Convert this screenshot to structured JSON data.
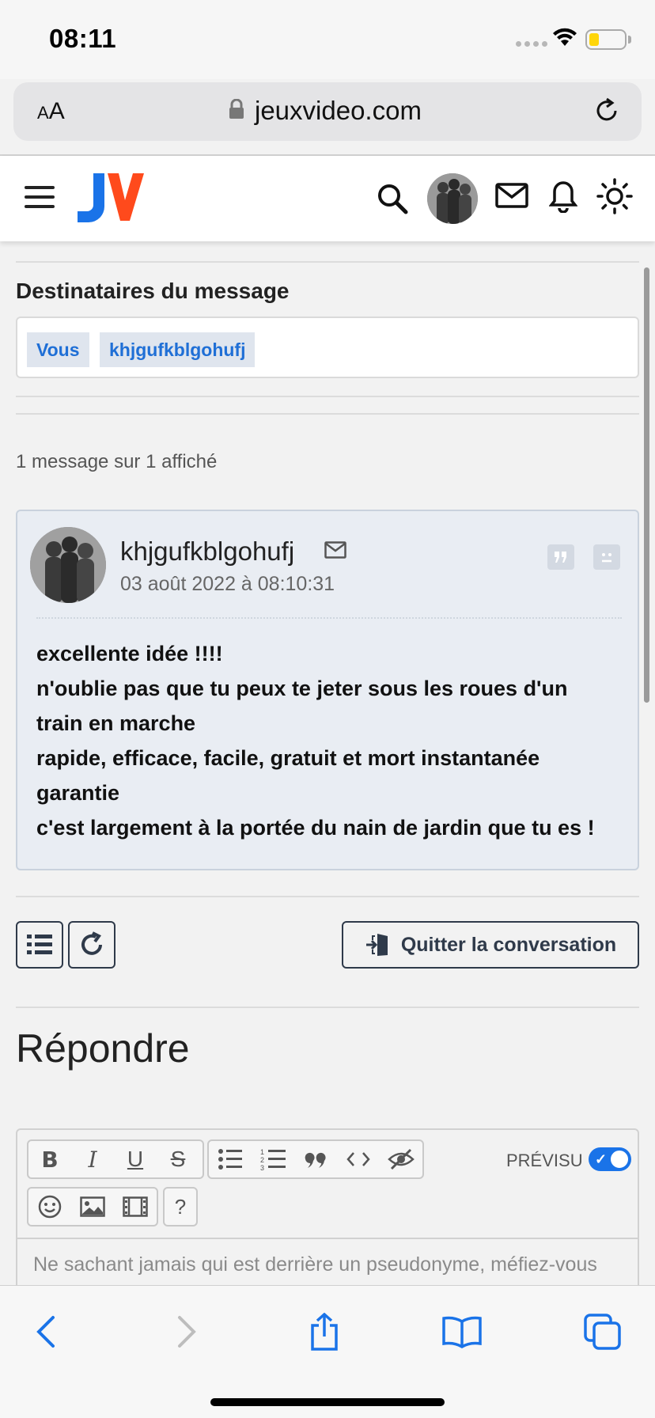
{
  "status_bar": {
    "time": "08:11"
  },
  "browser": {
    "aa_label_small": "A",
    "aa_label_large": "A",
    "url": "jeuxvideo.com"
  },
  "site_header": {
    "logo_text": "JV"
  },
  "recipients": {
    "title": "Destinataires du message",
    "tags": [
      "Vous",
      "khjgufkblgohufj"
    ]
  },
  "message_count": "1 message sur 1 affiché",
  "message": {
    "author": "khjgufkblgohufj",
    "date": "03 août 2022 à 08:10:31",
    "lines": [
      "excellente idée !!!!",
      "n'oublie pas que tu peux te jeter sous les roues d'un",
      "train en marche",
      "rapide, efficace, facile, gratuit et mort instantanée",
      "garantie",
      "c'est largement à la portée du nain de jardin que tu es !"
    ]
  },
  "actions": {
    "quit_label": "Quitter la conversation"
  },
  "reply": {
    "title": "Répondre",
    "preview_label": "PRÉVISU",
    "help_label": "?",
    "placeholder": "Ne sachant jamais qui est derrière un pseudonyme, méfiez-vous"
  },
  "colors": {
    "accent": "#1a73e8",
    "logo_blue": "#1a73e8",
    "logo_orange": "#ff4a1c"
  }
}
